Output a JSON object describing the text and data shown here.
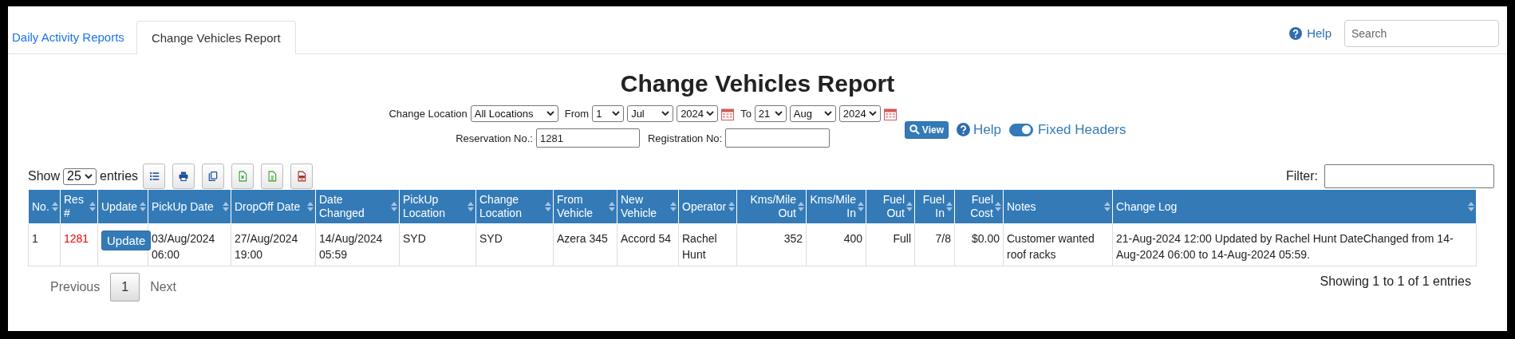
{
  "tabs": [
    {
      "label": "Daily Activity Reports",
      "selected": false
    },
    {
      "label": "Change Vehicles Report",
      "selected": true
    }
  ],
  "top_help": "Help",
  "search": {
    "placeholder": "Search"
  },
  "title": "Change Vehicles Report",
  "filters": {
    "change_location": {
      "label": "Change Location",
      "value": "All Locations"
    },
    "from": {
      "label": "From",
      "day": "1",
      "month": "Jul",
      "year": "2024"
    },
    "to": {
      "label": "To",
      "day": "21",
      "month": "Aug",
      "year": "2024"
    },
    "view_button": "View",
    "help": "Help",
    "fixed_headers": {
      "label": "Fixed Headers",
      "on": true
    },
    "reservation": {
      "label": "Reservation No.:",
      "value": "1281"
    },
    "registration": {
      "label": "Registration No:"
    }
  },
  "toolbar": {
    "show_label": "Show",
    "page_size": "25",
    "entries_label": "entries",
    "exports": [
      {
        "kind": "list"
      },
      {
        "kind": "print"
      },
      {
        "kind": "copy"
      },
      {
        "kind": "excel"
      },
      {
        "kind": "csv"
      },
      {
        "kind": "pdf"
      }
    ],
    "filter_label": "Filter:"
  },
  "table": {
    "columns": [
      {
        "label": "No.",
        "kind": "text"
      },
      {
        "label": "Res #",
        "kind": "link"
      },
      {
        "label": "Update",
        "kind": "button"
      },
      {
        "label": "PickUp Date",
        "kind": "text"
      },
      {
        "label": "DropOff Date",
        "kind": "text"
      },
      {
        "label": "Date Changed",
        "kind": "text"
      },
      {
        "label": "PickUp Location",
        "kind": "text"
      },
      {
        "label": "Change Location",
        "kind": "text"
      },
      {
        "label": "From Vehicle",
        "kind": "text"
      },
      {
        "label": "New Vehicle",
        "kind": "text"
      },
      {
        "label": "Operator",
        "kind": "text"
      },
      {
        "label": "Kms/Mile Out",
        "kind": "number"
      },
      {
        "label": "Kms/Mile In",
        "kind": "number"
      },
      {
        "label": "Fuel Out",
        "kind": "number"
      },
      {
        "label": "Fuel In",
        "kind": "number"
      },
      {
        "label": "Fuel Cost",
        "kind": "number"
      },
      {
        "label": "Notes",
        "kind": "text"
      },
      {
        "label": "Change Log",
        "kind": "text"
      }
    ],
    "rows": [
      {
        "cells": [
          "1",
          "1281",
          "Update",
          "03/Aug/2024 06:00",
          "27/Aug/2024 19:00",
          "14/Aug/2024 05:59",
          "SYD",
          "SYD",
          "Azera 345",
          "Accord 54",
          "Rachel Hunt",
          "352",
          "400",
          "Full",
          "7/8",
          "$0.00",
          "Customer wanted roof racks",
          "21-Aug-2024 12:00 Updated by Rachel Hunt DateChanged from 14-Aug-2024 06:00 to 14-Aug-2024 05:59."
        ]
      }
    ]
  },
  "pagination": {
    "previous": "Previous",
    "pages": [
      {
        "label": "1",
        "selected": true
      }
    ],
    "next": "Next",
    "info": "Showing 1 to 1 of 1 entries"
  }
}
